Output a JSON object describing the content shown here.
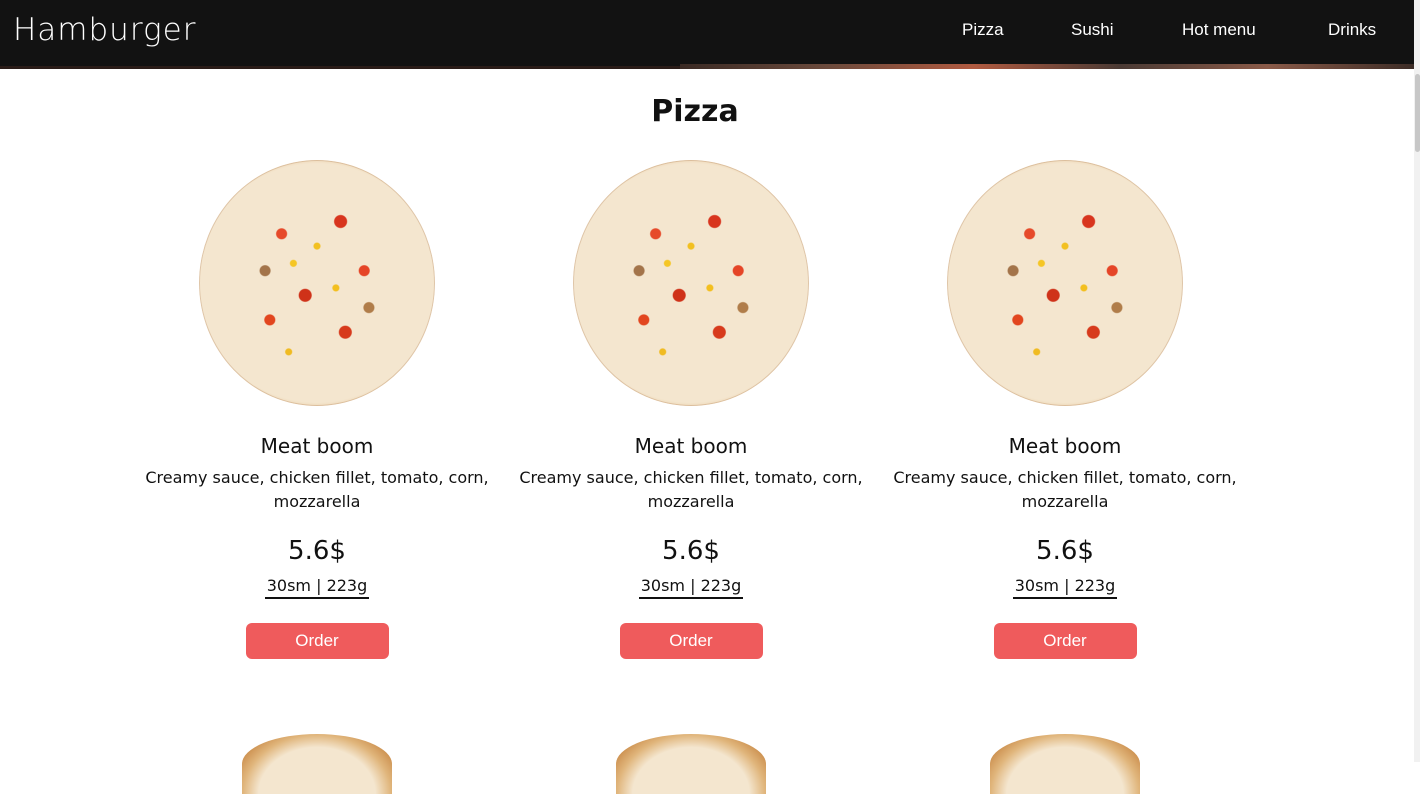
{
  "header": {
    "logo": "Hamburger",
    "nav": [
      "Pizza",
      "Sushi",
      "Hot menu",
      "Drinks"
    ]
  },
  "section": {
    "title": "Pizza"
  },
  "cards": [
    {
      "name": "Meat boom",
      "description": "Creamy sauce, chicken fillet, tomato, corn, mozzarella",
      "price": "5.6$",
      "size": "30sm | 223g",
      "order_label": "Order"
    },
    {
      "name": "Meat boom",
      "description": "Creamy sauce, chicken fillet, tomato, corn, mozzarella",
      "price": "5.6$",
      "size": "30sm | 223g",
      "order_label": "Order"
    },
    {
      "name": "Meat boom",
      "description": "Creamy sauce, chicken fillet, tomato, corn, mozzarella",
      "price": "5.6$",
      "size": "30sm | 223g",
      "order_label": "Order"
    }
  ],
  "colors": {
    "header_bg": "#121212",
    "order_button": "#ef5b5c"
  }
}
